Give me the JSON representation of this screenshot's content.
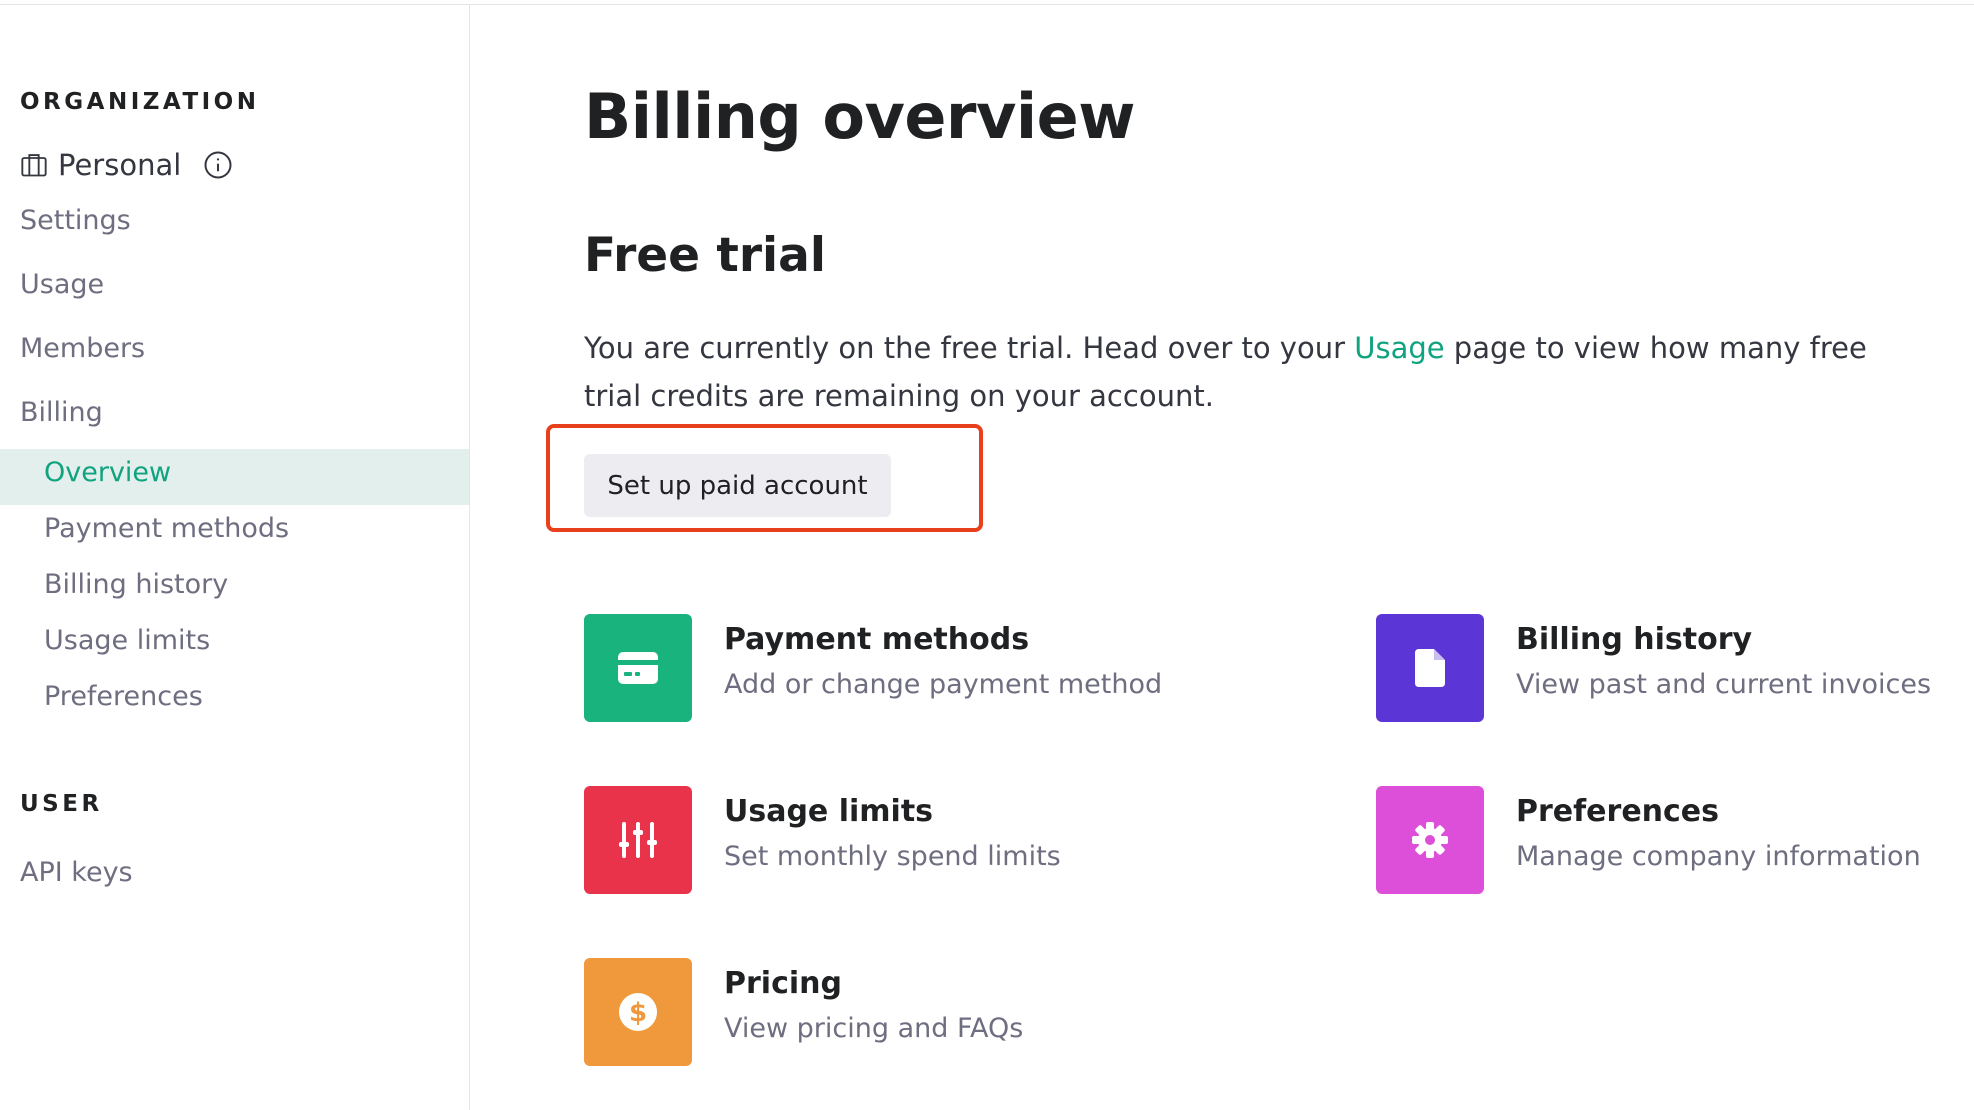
{
  "sidebar": {
    "org_section_label": "ORGANIZATION",
    "org_name": "Personal",
    "items": {
      "settings": "Settings",
      "usage": "Usage",
      "members": "Members",
      "billing": "Billing"
    },
    "billing_sub": {
      "overview": "Overview",
      "payment_methods": "Payment methods",
      "billing_history": "Billing history",
      "usage_limits": "Usage limits",
      "preferences": "Preferences"
    },
    "user_section_label": "USER",
    "api_keys": "API keys"
  },
  "main": {
    "title": "Billing overview",
    "section_title": "Free trial",
    "para_before": "You are currently on the free trial. Head over to your ",
    "para_link": "Usage",
    "para_after": " page to view how many free trial credits are remaining on your account.",
    "paid_button": "Set up paid account"
  },
  "cards": {
    "payment": {
      "title": "Payment methods",
      "desc": "Add or change payment method",
      "color": "#19b37d"
    },
    "history": {
      "title": "Billing history",
      "desc": "View past and current invoices",
      "color": "#5b35d5"
    },
    "limits": {
      "title": "Usage limits",
      "desc": "Set monthly spend limits",
      "color": "#e8334a"
    },
    "preferences": {
      "title": "Preferences",
      "desc": "Manage company information",
      "color": "#dd4fd8"
    },
    "pricing": {
      "title": "Pricing",
      "desc": "View pricing and FAQs",
      "color": "#f0993c"
    }
  },
  "colors": {
    "accent": "#10a37f",
    "highlight": "#e8401c",
    "active_bg": "#e2efec"
  },
  "icons": {
    "org": "briefcase-icon",
    "info": "info-icon",
    "payment": "credit-card-icon",
    "history": "document-icon",
    "limits": "sliders-icon",
    "preferences": "gear-icon",
    "pricing": "dollar-icon"
  }
}
